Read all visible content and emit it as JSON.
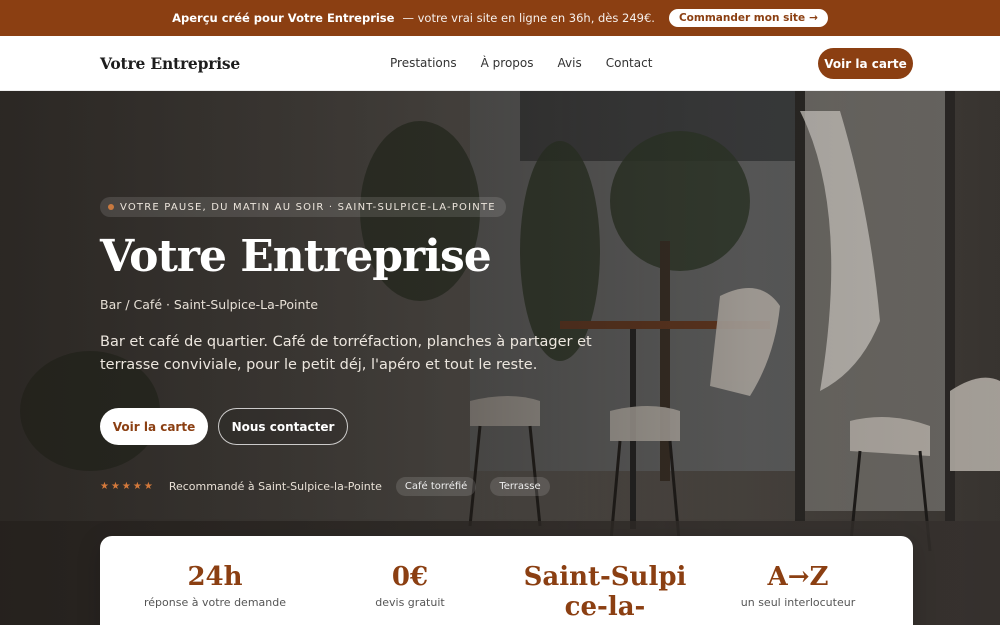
{
  "banner": {
    "lead": "Aperçu créé pour Votre Entreprise",
    "rest": "— votre vrai site en ligne en 36h, dès 249€.",
    "cta": "Commander mon site",
    "cta_arrow": "→"
  },
  "nav": {
    "brand": "Votre Entreprise",
    "items": [
      "Prestations",
      "À propos",
      "Avis",
      "Contact"
    ],
    "cta": "Voir la carte"
  },
  "hero": {
    "eyebrow": "VOTRE PAUSE, DU MATIN AU SOIR · SAINT-SULPICE-LA-POINTE",
    "title": "Votre Entreprise",
    "subtitle": "Bar / Café · Saint-Sulpice-La-Pointe",
    "description": "Bar et café de quartier. Café de torréfaction, planches à partager et terrasse conviviale, pour le petit déj, l'apéro et tout le reste.",
    "primary_button": "Voir la carte",
    "secondary_button": "Nous contacter",
    "stars": "★★★★★",
    "recommend": "Recommandé à Saint-Sulpice-la-Pointe",
    "chips": [
      "Café torréfié",
      "Terrasse"
    ]
  },
  "stats": [
    {
      "value": "24h",
      "label": "réponse à votre demande"
    },
    {
      "value": "0€",
      "label": "devis gratuit"
    },
    {
      "value": "Saint-Sulpice-la-",
      "label": ""
    },
    {
      "value": "A→Z",
      "label": "un seul interlocuteur"
    }
  ],
  "colors": {
    "brand": "#8b3f12",
    "accent_dot": "#c8793f",
    "stars": "#d4793b"
  }
}
